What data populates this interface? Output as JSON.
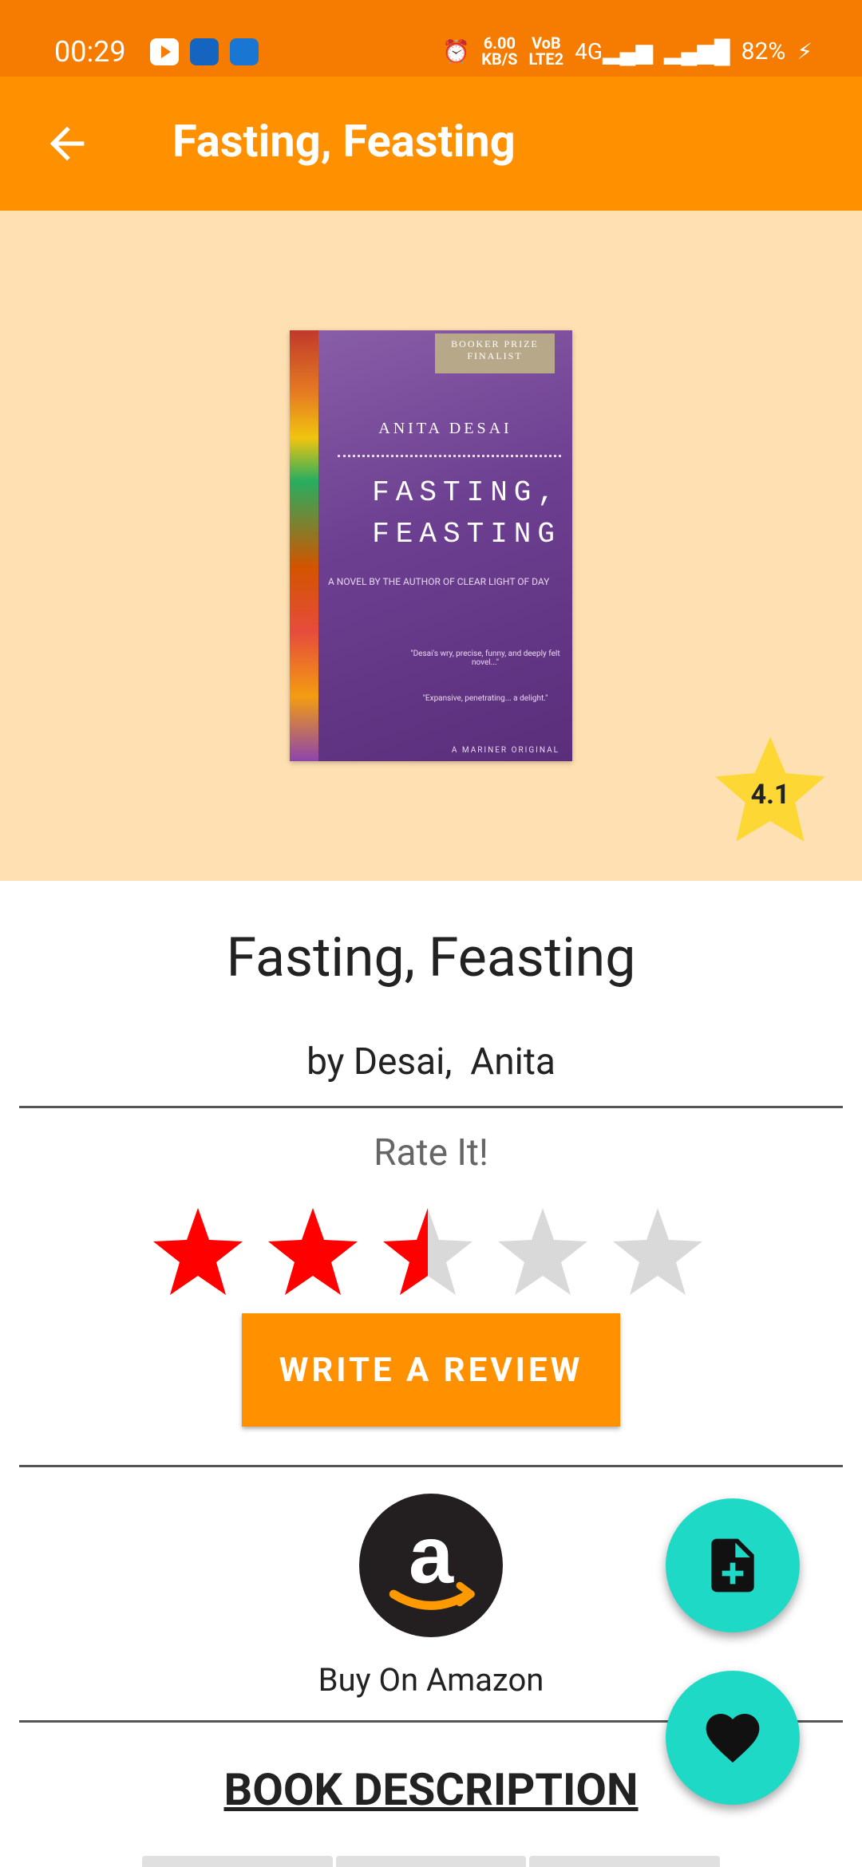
{
  "status_bar": {
    "time": "00:29",
    "speed_value": "6.00",
    "speed_unit": "KB/S",
    "volte": "VoB",
    "lte": "LTE2",
    "network": "4G",
    "battery": "82%"
  },
  "app_bar": {
    "title": "Fasting, Feasting",
    "back_icon": "arrow-back-icon"
  },
  "cover": {
    "badge": "BOOKER PRIZE FINALIST",
    "author": "ANITA DESAI",
    "title_line1": "FASTING,",
    "title_line2": "FEASTING",
    "subtitle": "A NOVEL BY THE AUTHOR OF CLEAR LIGHT OF DAY",
    "blurb1": "\"Desai's wry, precise, funny, and deeply felt novel...\"",
    "blurb2": "\"Expansive, penetrating... a delight.\"",
    "publisher": "A MARINER ORIGINAL"
  },
  "rating": {
    "average": "4.1",
    "badge_color": "#FDD835"
  },
  "book": {
    "title": "Fasting, Feasting",
    "author": "by Desai,  Anita"
  },
  "user_rating": {
    "label": "Rate It!",
    "value": 2.5,
    "max": 5,
    "filled_color": "#FF0000",
    "empty_color": "#D9D9D9"
  },
  "actions": {
    "write_review": "WRITE A REVIEW",
    "amazon_label": "Buy On Amazon",
    "amazon_icon": "amazon-logo-icon"
  },
  "description": {
    "heading": "BOOK DESCRIPTION"
  },
  "fabs": {
    "add_note_icon": "note-add-icon",
    "favorite_icon": "heart-icon",
    "color": "#1DD9C6"
  },
  "colors": {
    "status_bar": "#F57C00",
    "app_bar": "#FF9100",
    "hero_bg": "#FFE0B2"
  }
}
